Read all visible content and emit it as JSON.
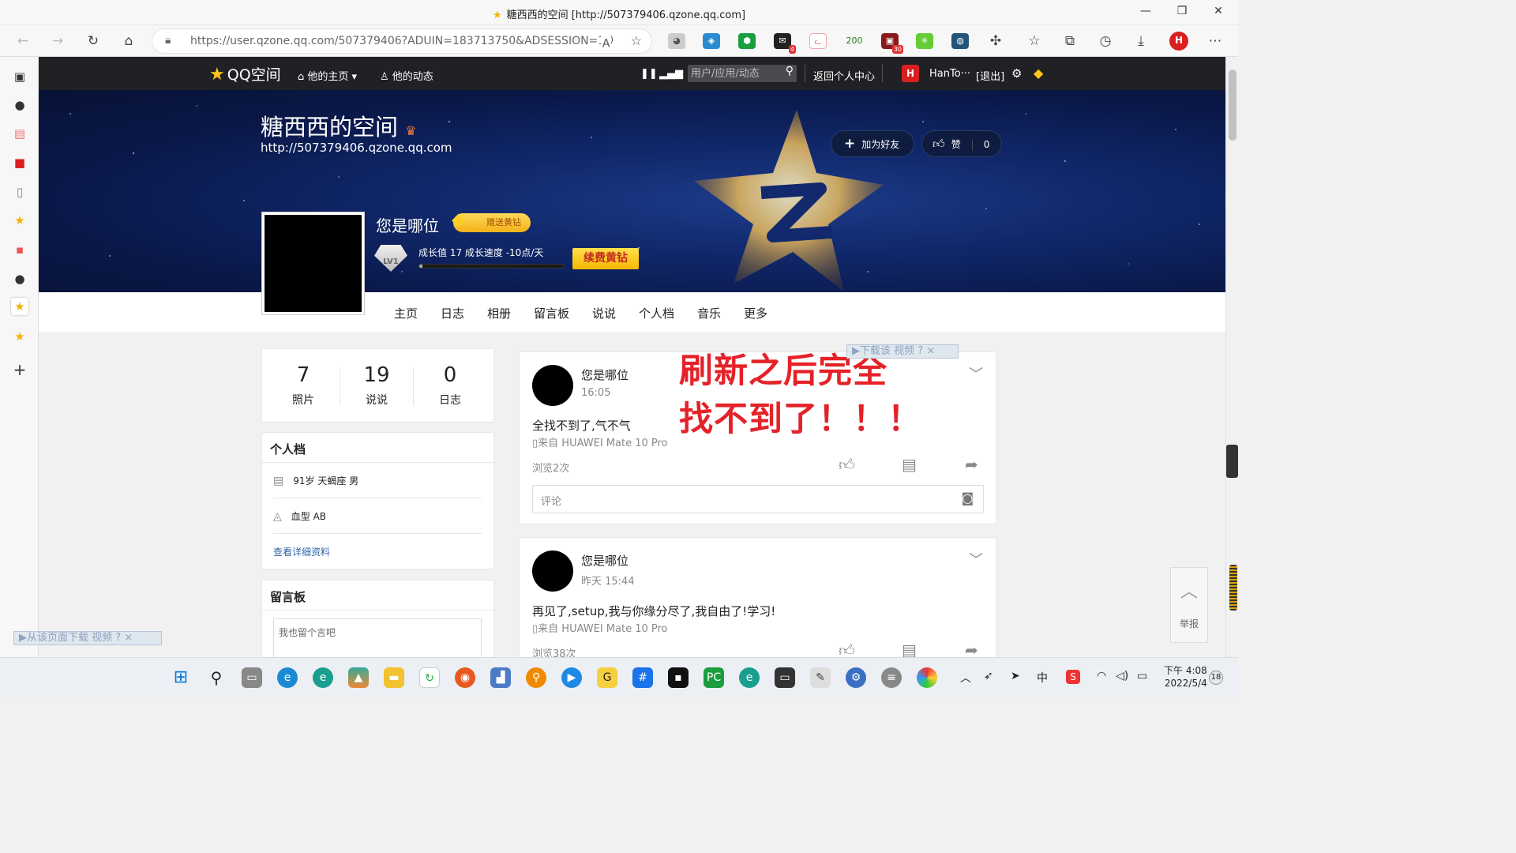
{
  "window": {
    "title": "糖西西的空间 [http://507379406.qzone.qq.com]"
  },
  "browser": {
    "url": "https://user.qzone.qq.com/507379406?ADUIN=183713750&ADSESSION=1651...",
    "extension_badges": {
      "mail": "4",
      "game": "30",
      "counter": "200"
    }
  },
  "qzone_bar": {
    "logo": "QQ空间",
    "home_menu": "他的主页",
    "activity": "他的动态",
    "search_placeholder": "用户/应用/动态",
    "back_center": "返回个人中心",
    "user_name": "HanTo···",
    "logout": "[退出]"
  },
  "banner": {
    "space_title": "糖西西的空间",
    "space_url": "http://507379406.qzone.qq.com",
    "add_friend": "加为好友",
    "like_label": "赞",
    "like_count": "0",
    "nickname": "您是哪位",
    "gift_vip": "赠送黄钻",
    "level": "LV1",
    "growth_text": "成长值 17   成长速度 -10点/天",
    "growth_progress": 0.02,
    "renew_vip": "续费黄钻"
  },
  "tabs": [
    "主页",
    "日志",
    "相册",
    "留言板",
    "说说",
    "个人档",
    "音乐",
    "更多"
  ],
  "stats": [
    {
      "num": "7",
      "label": "照片"
    },
    {
      "num": "19",
      "label": "说说"
    },
    {
      "num": "0",
      "label": "日志"
    }
  ],
  "profile": {
    "title": "个人档",
    "info1": "91岁  天蝎座 男",
    "info2": "血型 AB",
    "detail_link": "查看详细资料"
  },
  "guestbook": {
    "title": "留言板",
    "placeholder": "我也留个言吧"
  },
  "feeds": [
    {
      "name": "您是哪位",
      "time": "16:05",
      "text": "全找不到了,气不气",
      "source": "来自 HUAWEI Mate 10 Pro",
      "views": "浏览2次",
      "comment_placeholder": "评论"
    },
    {
      "name": "您是哪位",
      "time": "昨天 15:44",
      "text": "再见了,setup,我与你缘分尽了,我自由了!学习!",
      "source": "来自 HUAWEI Mate 10 Pro",
      "views": "浏览38次"
    }
  ],
  "annotation": {
    "line1": "刷新之后完全",
    "line2": "找不到了！！！"
  },
  "download_bars": {
    "top": "▶下载该 视频",
    "bottom": "▶从该页面下载 视频",
    "help": "?",
    "close": "×"
  },
  "float": {
    "report": "举报"
  },
  "taskbar": {
    "ime": "中",
    "time": "下午 4:08",
    "date": "2022/5/4",
    "notif_count": "18"
  },
  "colors": {
    "qzone_bar": "#202124",
    "red_annotation": "#e52229",
    "vip_gold": "#f5b800"
  }
}
